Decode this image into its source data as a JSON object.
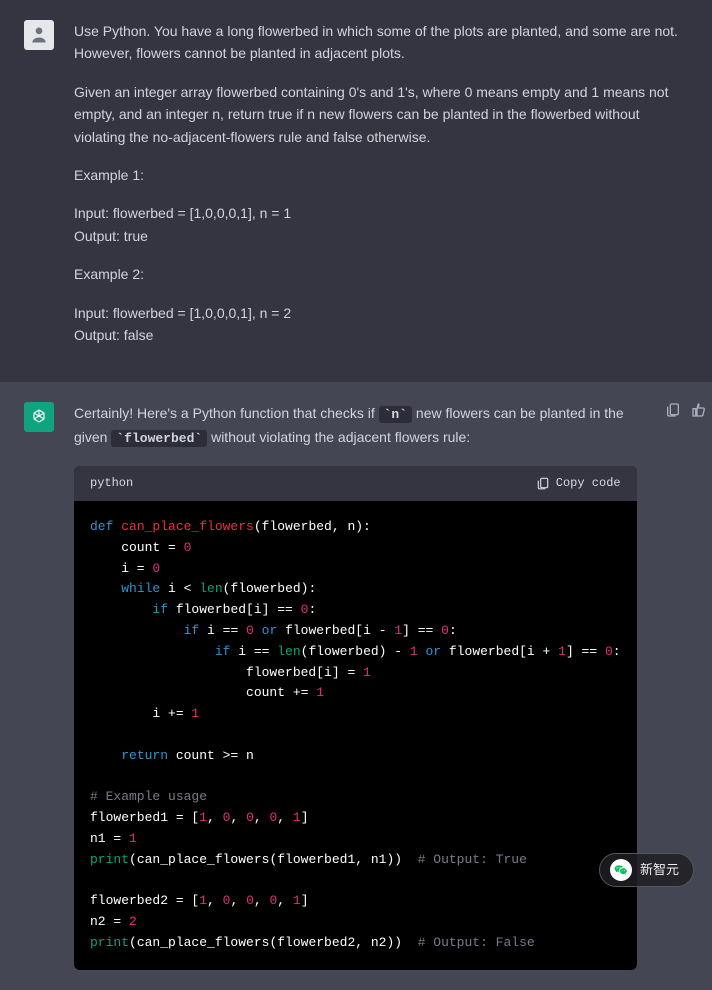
{
  "user": {
    "paragraphs": [
      "Use Python. You have a long flowerbed in which some of the plots are planted, and some are not. However, flowers cannot be planted in adjacent plots.",
      "Given an integer array flowerbed containing 0's and 1's, where 0 means empty and 1 means not empty, and an integer n, return true if n new flowers can be planted in the flowerbed without violating the no-adjacent-flowers rule and false otherwise.",
      "Example 1:",
      "Input: flowerbed = [1,0,0,0,1], n = 1\nOutput: true",
      "Example 2:",
      "Input: flowerbed = [1,0,0,0,1], n = 2\nOutput: false"
    ]
  },
  "assistant": {
    "intro_before_code1": "Certainly! Here's a Python function that checks if ",
    "code1": "`n`",
    "intro_mid": " new flowers can be planted in the given ",
    "code2": "`flowerbed`",
    "intro_after": " without violating the adjacent flowers rule:"
  },
  "codeblock": {
    "language": "python",
    "copy_label": "Copy code",
    "lines": [
      [
        [
          "k",
          "def "
        ],
        [
          "fn",
          "can_place_flowers"
        ],
        [
          "",
          "(flowerbed, n):"
        ]
      ],
      [
        [
          "",
          "    count = "
        ],
        [
          "n",
          "0"
        ]
      ],
      [
        [
          "",
          "    i = "
        ],
        [
          "n",
          "0"
        ]
      ],
      [
        [
          "",
          "    "
        ],
        [
          "k",
          "while"
        ],
        [
          "",
          " i < "
        ],
        [
          "sp",
          "len"
        ],
        [
          "",
          "(flowerbed):"
        ]
      ],
      [
        [
          "",
          "        "
        ],
        [
          "k",
          "if"
        ],
        [
          "",
          " flowerbed[i] == "
        ],
        [
          "n",
          "0"
        ],
        [
          "",
          ":"
        ]
      ],
      [
        [
          "",
          "            "
        ],
        [
          "k",
          "if"
        ],
        [
          "",
          " i == "
        ],
        [
          "n",
          "0"
        ],
        [
          "",
          " "
        ],
        [
          "k",
          "or"
        ],
        [
          "",
          " flowerbed[i - "
        ],
        [
          "n",
          "1"
        ],
        [
          "",
          "] == "
        ],
        [
          "n",
          "0"
        ],
        [
          "",
          ":"
        ]
      ],
      [
        [
          "",
          "                "
        ],
        [
          "k",
          "if"
        ],
        [
          "",
          " i == "
        ],
        [
          "sp",
          "len"
        ],
        [
          "",
          "(flowerbed) - "
        ],
        [
          "n",
          "1"
        ],
        [
          "",
          " "
        ],
        [
          "k",
          "or"
        ],
        [
          "",
          " flowerbed[i + "
        ],
        [
          "n",
          "1"
        ],
        [
          "",
          "] == "
        ],
        [
          "n",
          "0"
        ],
        [
          "",
          ":"
        ]
      ],
      [
        [
          "",
          "                    flowerbed[i] = "
        ],
        [
          "n",
          "1"
        ]
      ],
      [
        [
          "",
          "                    count += "
        ],
        [
          "n",
          "1"
        ]
      ],
      [
        [
          "",
          "        i += "
        ],
        [
          "n",
          "1"
        ]
      ],
      [
        [
          "",
          ""
        ]
      ],
      [
        [
          "",
          "    "
        ],
        [
          "k",
          "return"
        ],
        [
          "",
          " count >= n"
        ]
      ],
      [
        [
          "",
          ""
        ]
      ],
      [
        [
          "c",
          "# Example usage"
        ]
      ],
      [
        [
          "",
          "flowerbed1 = ["
        ],
        [
          "n",
          "1"
        ],
        [
          "",
          ", "
        ],
        [
          "n",
          "0"
        ],
        [
          "",
          ", "
        ],
        [
          "n",
          "0"
        ],
        [
          "",
          ", "
        ],
        [
          "n",
          "0"
        ],
        [
          "",
          ", "
        ],
        [
          "n",
          "1"
        ],
        [
          "",
          "]"
        ]
      ],
      [
        [
          "",
          "n1 = "
        ],
        [
          "n",
          "1"
        ]
      ],
      [
        [
          "sp",
          "print"
        ],
        [
          "",
          "(can_place_flowers(flowerbed1, n1))  "
        ],
        [
          "c",
          "# Output: True"
        ]
      ],
      [
        [
          "",
          ""
        ]
      ],
      [
        [
          "",
          "flowerbed2 = ["
        ],
        [
          "n",
          "1"
        ],
        [
          "",
          ", "
        ],
        [
          "n",
          "0"
        ],
        [
          "",
          ", "
        ],
        [
          "n",
          "0"
        ],
        [
          "",
          ", "
        ],
        [
          "n",
          "0"
        ],
        [
          "",
          ", "
        ],
        [
          "n",
          "1"
        ],
        [
          "",
          "]"
        ]
      ],
      [
        [
          "",
          "n2 = "
        ],
        [
          "n",
          "2"
        ]
      ],
      [
        [
          "sp",
          "print"
        ],
        [
          "",
          "(can_place_flowers(flowerbed2, n2))  "
        ],
        [
          "c",
          "# Output: False"
        ]
      ]
    ]
  },
  "watermark": {
    "text": "新智元"
  }
}
